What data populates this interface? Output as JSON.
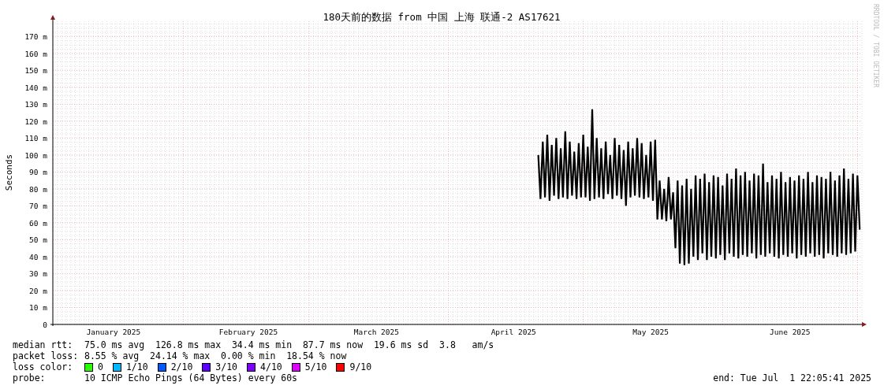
{
  "chart": {
    "credit": "RRDTOOL / TOBI OETIKER",
    "chart_data": {
      "type": "line",
      "grid": true,
      "title": "180天前的数据 from 中国 上海 联通-2 AS17621",
      "ylabel": "Seconds",
      "ylim": [
        0,
        179
      ],
      "yticks": [
        {
          "value": 0,
          "label": "0"
        },
        {
          "value": 10,
          "label": "10 m"
        },
        {
          "value": 20,
          "label": "20 m"
        },
        {
          "value": 30,
          "label": "30 m"
        },
        {
          "value": 40,
          "label": "40 m"
        },
        {
          "value": 50,
          "label": "50 m"
        },
        {
          "value": 60,
          "label": "60 m"
        },
        {
          "value": 70,
          "label": "70 m"
        },
        {
          "value": 80,
          "label": "80 m"
        },
        {
          "value": 90,
          "label": "90 m"
        },
        {
          "value": 100,
          "label": "100 m"
        },
        {
          "value": 110,
          "label": "110 m"
        },
        {
          "value": 120,
          "label": "120 m"
        },
        {
          "value": 130,
          "label": "130 m"
        },
        {
          "value": 140,
          "label": "140 m"
        },
        {
          "value": 150,
          "label": "150 m"
        },
        {
          "value": 160,
          "label": "160 m"
        },
        {
          "value": 170,
          "label": "170 m"
        }
      ],
      "categories": [
        null,
        null,
        null,
        null,
        null,
        null,
        null,
        null,
        null,
        null,
        null,
        null,
        null,
        null,
        null,
        null,
        null,
        null,
        null,
        null,
        null,
        null,
        null,
        null,
        null,
        null,
        null,
        "January 2025",
        null,
        null,
        null,
        null,
        null,
        null,
        null,
        null,
        null,
        null,
        null,
        null,
        null,
        null,
        null,
        null,
        null,
        null,
        null,
        null,
        null,
        null,
        null,
        null,
        null,
        null,
        null,
        null,
        null,
        null,
        null,
        null,
        null,
        null,
        null,
        null,
        null,
        null,
        null,
        null,
        null,
        null,
        null,
        null,
        null,
        null,
        null,
        null,
        null,
        null,
        null,
        null,
        null,
        null,
        null,
        null,
        null,
        null,
        null,
        "February 2025",
        null,
        null,
        null,
        null,
        null,
        null,
        null,
        null,
        null,
        null,
        null,
        null,
        null,
        null,
        null,
        null,
        null,
        null,
        null,
        null,
        null,
        null,
        null,
        null,
        null,
        null,
        null,
        null,
        null,
        null,
        null,
        null,
        null,
        null,
        null,
        null,
        null,
        null,
        null,
        null,
        null,
        null,
        null,
        null,
        null,
        null,
        null,
        null,
        null,
        null,
        null,
        null,
        null,
        null,
        null,
        null,
        "March 2025",
        null,
        null,
        null,
        null,
        null,
        null,
        null,
        null,
        null,
        null,
        null,
        null,
        null,
        null,
        null,
        null,
        null,
        null,
        null,
        null,
        null,
        null,
        null,
        null,
        null,
        null,
        null,
        null,
        null,
        null,
        null,
        null,
        null,
        null,
        null,
        null,
        null,
        null,
        null,
        null,
        null,
        null,
        null,
        null,
        null,
        null,
        null,
        null,
        null,
        null,
        null,
        null,
        null,
        null,
        null,
        null,
        null,
        null,
        null,
        null,
        "April 2025",
        null,
        null,
        null,
        null,
        null,
        null,
        null,
        null,
        null,
        null,
        null,
        null,
        null,
        null,
        null,
        null,
        null,
        null,
        null,
        null,
        null,
        null,
        null,
        null,
        null,
        null,
        null,
        null,
        null,
        null,
        null,
        null,
        null,
        null,
        null,
        null,
        null,
        null,
        null,
        null,
        null,
        null,
        null,
        null,
        null,
        null,
        null,
        null,
        null,
        null,
        null,
        null,
        null,
        null,
        null,
        null,
        null,
        null,
        null,
        null,
        "May 2025",
        null,
        null,
        null,
        null,
        null,
        null,
        null,
        null,
        null,
        null,
        null,
        null,
        null,
        null,
        null,
        null,
        null,
        null,
        null,
        null,
        null,
        null,
        null,
        null,
        null,
        null,
        null,
        null,
        null,
        null,
        null,
        null,
        null,
        null,
        null,
        null,
        null,
        null,
        null,
        null,
        null,
        null,
        null,
        null,
        null,
        null,
        null,
        null,
        null,
        null,
        null,
        null,
        null,
        null,
        null,
        null,
        null,
        null,
        null,
        null,
        null,
        "June 2025",
        null,
        null,
        null,
        null,
        null,
        null,
        null,
        null,
        null,
        null,
        null,
        null,
        null,
        null,
        null,
        null,
        null,
        null,
        null,
        null,
        null,
        null,
        null,
        null,
        null,
        null,
        null,
        null,
        null,
        null,
        null
      ],
      "series": [
        {
          "name": "median rtt:",
          "color": "#000000",
          "values": [
            null,
            null,
            null,
            null,
            null,
            null,
            null,
            null,
            null,
            null,
            null,
            null,
            null,
            null,
            null,
            null,
            null,
            null,
            null,
            null,
            null,
            null,
            null,
            null,
            null,
            null,
            null,
            null,
            null,
            null,
            null,
            null,
            null,
            null,
            null,
            null,
            null,
            null,
            null,
            null,
            null,
            null,
            null,
            null,
            null,
            null,
            null,
            null,
            null,
            null,
            null,
            null,
            null,
            null,
            null,
            null,
            null,
            null,
            null,
            null,
            null,
            null,
            null,
            null,
            null,
            null,
            null,
            null,
            null,
            null,
            null,
            null,
            null,
            null,
            null,
            null,
            null,
            null,
            null,
            null,
            null,
            null,
            null,
            null,
            null,
            null,
            null,
            null,
            null,
            null,
            null,
            null,
            null,
            null,
            null,
            null,
            null,
            null,
            null,
            null,
            null,
            null,
            null,
            null,
            null,
            null,
            null,
            null,
            null,
            null,
            null,
            null,
            null,
            null,
            null,
            null,
            null,
            null,
            null,
            null,
            null,
            null,
            null,
            null,
            null,
            null,
            null,
            null,
            null,
            null,
            null,
            null,
            null,
            null,
            null,
            null,
            null,
            null,
            null,
            null,
            null,
            null,
            null,
            null,
            null,
            null,
            null,
            null,
            null,
            null,
            null,
            null,
            null,
            null,
            null,
            null,
            null,
            null,
            null,
            null,
            null,
            null,
            null,
            null,
            null,
            null,
            null,
            null,
            null,
            null,
            null,
            null,
            null,
            null,
            null,
            null,
            null,
            null,
            null,
            null,
            null,
            null,
            null,
            null,
            null,
            null,
            null,
            null,
            null,
            null,
            null,
            null,
            null,
            null,
            null,
            null,
            null,
            null,
            null,
            null,
            null,
            null,
            null,
            null,
            null,
            null,
            null,
            null,
            null,
            null,
            null,
            null,
            null,
            null,
            null,
            null,
            100,
            74,
            108,
            75,
            112,
            73,
            106,
            76,
            110,
            74,
            104,
            75,
            114,
            74,
            108,
            76,
            102,
            74,
            107,
            75,
            112,
            75,
            105,
            73,
            127,
            74,
            110,
            75,
            104,
            74,
            108,
            77,
            100,
            74,
            110,
            76,
            106,
            74,
            103,
            70,
            108,
            75,
            104,
            76,
            110,
            75,
            107,
            74,
            100,
            75,
            108,
            73,
            109,
            62,
            85,
            62,
            80,
            61,
            87,
            62,
            78,
            45,
            85,
            36,
            82,
            35,
            86,
            36,
            80,
            40,
            88,
            38,
            86,
            42,
            89,
            38,
            84,
            40,
            88,
            39,
            87,
            41,
            82,
            38,
            89,
            42,
            86,
            40,
            92,
            39,
            88,
            41,
            90,
            40,
            85,
            42,
            89,
            39,
            88,
            41,
            95,
            40,
            84,
            42,
            88,
            40,
            86,
            39,
            90,
            41,
            84,
            40,
            87,
            42,
            85,
            39,
            88,
            41,
            86,
            40,
            90,
            42,
            84,
            40,
            88,
            41,
            87,
            39,
            86,
            42,
            90,
            41,
            85,
            40,
            88,
            42,
            92,
            41,
            86,
            42,
            89,
            43,
            88,
            56
          ]
        }
      ]
    }
  },
  "median_rtt": {
    "text": "75.0 ms avg  126.8 ms max  34.4 ms min  87.7 ms now  19.6 ms sd  3.8   am/s"
  },
  "packet_loss": {
    "label": "packet loss:",
    "text": "8.55 % avg  24.14 % max  0.00 % min  18.54 % now"
  },
  "loss_color": {
    "label": "loss color:",
    "items": [
      {
        "label": "0",
        "color": "#26ff00"
      },
      {
        "label": "1/10",
        "color": "#00b8ff"
      },
      {
        "label": "2/10",
        "color": "#0059ff"
      },
      {
        "label": "3/10",
        "color": "#5e00ff"
      },
      {
        "label": "4/10",
        "color": "#7e00ff"
      },
      {
        "label": "5/10",
        "color": "#dd00ff"
      },
      {
        "label": "9/10",
        "color": "#ff0000"
      }
    ]
  },
  "probe": {
    "label": "probe:",
    "text": "10 ICMP Echo Pings (64 Bytes) every 60s"
  },
  "end": "end: Tue Jul  1 22:05:41 2025"
}
